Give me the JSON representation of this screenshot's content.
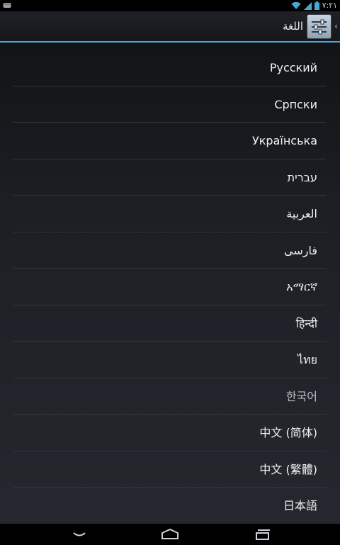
{
  "status_bar": {
    "time": "٧:٢١",
    "icons": [
      "notification-icon",
      "wifi-icon",
      "battery-icon"
    ]
  },
  "action_bar": {
    "title": "اللغة",
    "icons": [
      "settings-app-icon",
      "up-chevron-icon"
    ]
  },
  "languages": {
    "items": [
      {
        "label": "Русский"
      },
      {
        "label": "Српски"
      },
      {
        "label": "Українська"
      },
      {
        "label": "עברית"
      },
      {
        "label": "العربية"
      },
      {
        "label": "فارسی"
      },
      {
        "label": "አማርኛ"
      },
      {
        "label": "हिन्दी"
      },
      {
        "label": "ไทย"
      },
      {
        "label": "한국어"
      },
      {
        "label": "中文 (简体)"
      },
      {
        "label": "中文 (繁體)"
      },
      {
        "label": "日本語"
      }
    ]
  },
  "nav_bar": {
    "icons": [
      "back-icon",
      "home-icon",
      "recents-icon"
    ]
  },
  "colors": {
    "accent": "#4ba8d4",
    "background": "#1c1f24",
    "text": "#f0f0f0"
  }
}
